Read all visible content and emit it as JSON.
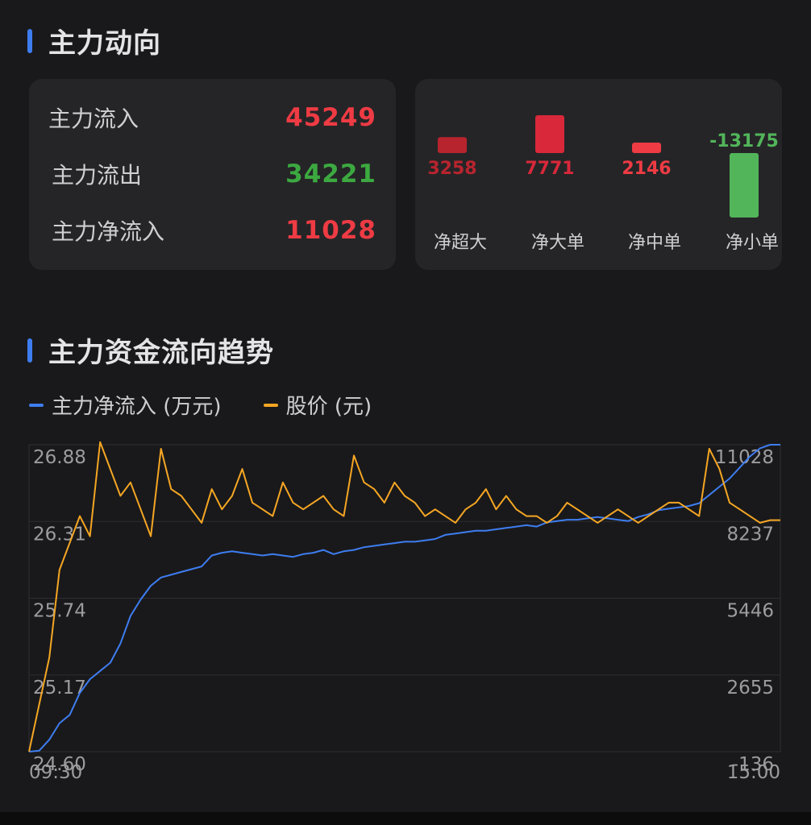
{
  "section1": {
    "title": "主力动向"
  },
  "flow": {
    "rows": [
      {
        "label": "主力流入",
        "value": "45249",
        "color": "#ee3b44"
      },
      {
        "label": "主力流出",
        "value": "34221",
        "color": "#3ca940"
      },
      {
        "label": "主力净流入",
        "value": "11028",
        "color": "#ee3b44"
      }
    ]
  },
  "net_bars": {
    "type": "bar",
    "categories": [
      "净超大",
      "净大单",
      "净中单",
      "净小单"
    ],
    "values": [
      3258,
      7771,
      2146,
      -13175
    ],
    "labels": [
      "3258",
      "7771",
      "2146",
      "-13175"
    ],
    "colors": [
      "#b8242e",
      "#d8283a",
      "#ee3b44",
      "#52b55a"
    ]
  },
  "section2": {
    "title": "主力资金流向趋势"
  },
  "legend": {
    "items": [
      {
        "label": "主力净流入 (万元)",
        "color": "#3e7df0"
      },
      {
        "label": "股价 (元)",
        "color": "#f5a623"
      }
    ]
  },
  "chart_data": {
    "type": "line",
    "x_start_label": "09:30",
    "x_end_label": "15:00",
    "left_axis": {
      "ticks": [
        "26.88",
        "26.31",
        "25.74",
        "25.17",
        "24.60"
      ],
      "ylim": [
        24.6,
        26.88
      ]
    },
    "right_axis": {
      "ticks": [
        "11028",
        "8237",
        "5446",
        "2655",
        "-136"
      ],
      "ylim": [
        -136,
        11028
      ]
    },
    "series": [
      {
        "name": "主力净流入 (万元)",
        "color": "#3e7df0",
        "axis": "right",
        "values": [
          -136,
          -100,
          300,
          900,
          1200,
          2000,
          2500,
          2800,
          3100,
          3800,
          4800,
          5400,
          5900,
          6200,
          6300,
          6400,
          6500,
          6600,
          7000,
          7100,
          7150,
          7100,
          7050,
          7000,
          7050,
          7000,
          6950,
          7050,
          7100,
          7200,
          7050,
          7150,
          7200,
          7300,
          7350,
          7400,
          7450,
          7500,
          7500,
          7550,
          7600,
          7750,
          7800,
          7850,
          7900,
          7900,
          7950,
          8000,
          8050,
          8100,
          8050,
          8200,
          8250,
          8300,
          8300,
          8350,
          8400,
          8350,
          8300,
          8250,
          8400,
          8500,
          8650,
          8700,
          8750,
          8800,
          8900,
          9200,
          9500,
          9800,
          10200,
          10600,
          10900,
          11028,
          11028
        ]
      },
      {
        "name": "股价 (元)",
        "color": "#f5a623",
        "axis": "left",
        "values": [
          24.6,
          24.95,
          25.3,
          25.95,
          26.15,
          26.35,
          26.2,
          26.9,
          26.7,
          26.5,
          26.6,
          26.4,
          26.2,
          26.85,
          26.55,
          26.5,
          26.4,
          26.3,
          26.55,
          26.4,
          26.5,
          26.7,
          26.45,
          26.4,
          26.35,
          26.6,
          26.45,
          26.4,
          26.45,
          26.5,
          26.4,
          26.35,
          26.8,
          26.6,
          26.55,
          26.45,
          26.6,
          26.5,
          26.45,
          26.35,
          26.4,
          26.35,
          26.3,
          26.4,
          26.45,
          26.55,
          26.4,
          26.5,
          26.4,
          26.35,
          26.35,
          26.3,
          26.35,
          26.45,
          26.4,
          26.35,
          26.3,
          26.35,
          26.4,
          26.35,
          26.3,
          26.35,
          26.4,
          26.45,
          26.45,
          26.4,
          26.35,
          26.85,
          26.7,
          26.45,
          26.4,
          26.35,
          26.3,
          26.32,
          26.32
        ]
      }
    ],
    "grid": true
  }
}
